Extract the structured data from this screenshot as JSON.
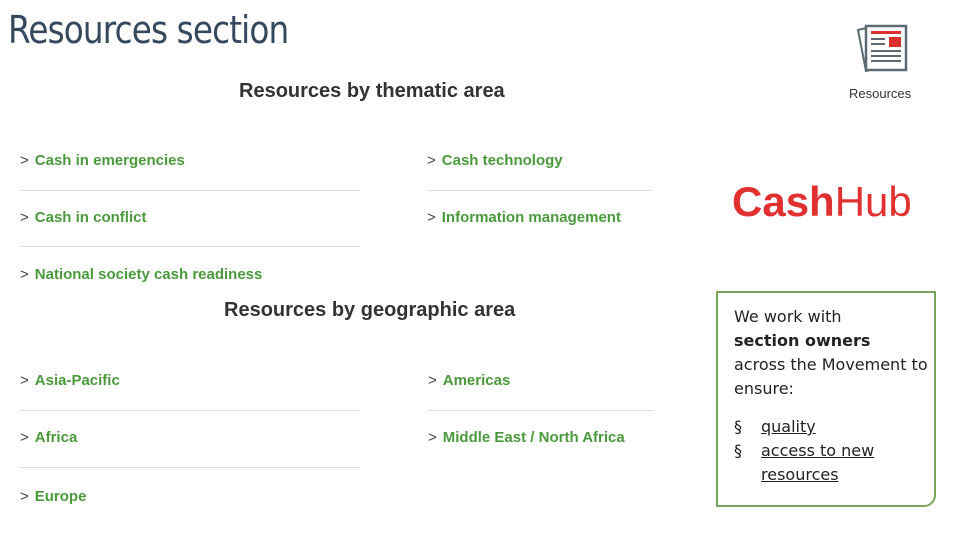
{
  "title": "Resources section",
  "thematic": {
    "heading": "Resources by thematic area",
    "items": [
      "Cash in emergencies",
      "Cash technology",
      "Cash in conflict",
      "Information management",
      "National society cash readiness"
    ]
  },
  "geographic": {
    "heading": "Resources by geographic area",
    "items": [
      "Asia-Pacific",
      "Americas",
      "Africa",
      "Middle East / North Africa",
      "Europe"
    ]
  },
  "resources_icon": {
    "icon": "newspaper-icon",
    "label": "Resources"
  },
  "logo": {
    "part1": "Cash",
    "part2": "Hub"
  },
  "note": {
    "line1": "We work with",
    "bold": "section owners",
    "line2": "across the Movement to ensure:",
    "bullets": [
      "quality",
      "access to new resources"
    ]
  },
  "colors": {
    "link": "#4a9a3c",
    "logo": "#e0302f",
    "border": "#7aa55a"
  }
}
